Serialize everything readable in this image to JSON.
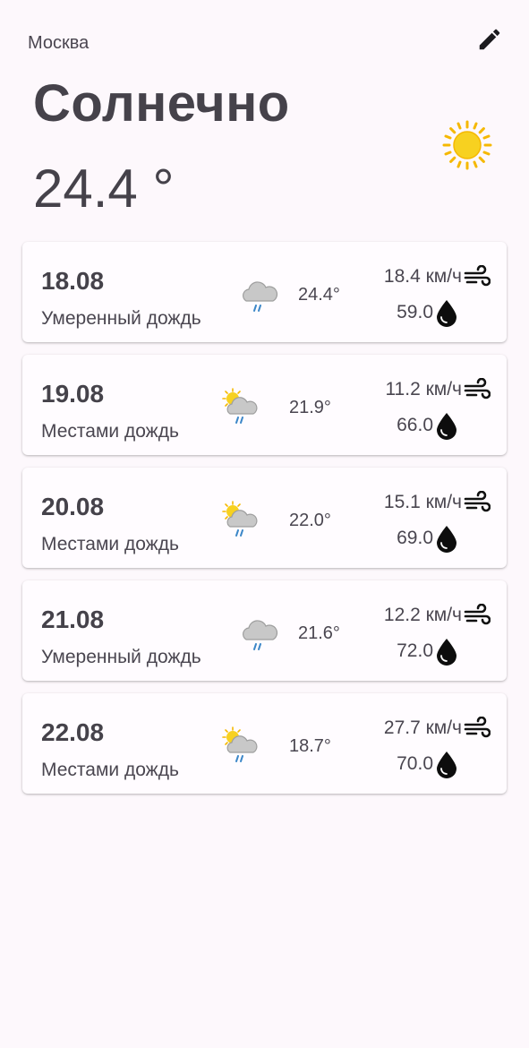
{
  "header": {
    "city": "Москва",
    "edit_icon": "pencil-icon",
    "condition": "Солнечно",
    "temperature": "24.4 °",
    "condition_icon": "sun-icon"
  },
  "colors": {
    "background": "#fdf8fc",
    "text": "#45424a",
    "sun": "#f7d120",
    "cloud": "#b5b5b5",
    "rain": "#3c87c8"
  },
  "forecast": [
    {
      "date": "18.08",
      "description": "Умеренный дождь",
      "icon": "rain-cloud-icon",
      "temp": "24.4°",
      "wind": "18.4 км/ч",
      "humidity": "59.0"
    },
    {
      "date": "19.08",
      "description": "Местами дождь",
      "icon": "sun-cloud-rain-icon",
      "temp": "21.9°",
      "wind": "11.2 км/ч",
      "humidity": "66.0"
    },
    {
      "date": "20.08",
      "description": "Местами дождь",
      "icon": "sun-cloud-rain-icon",
      "temp": "22.0°",
      "wind": "15.1 км/ч",
      "humidity": "69.0"
    },
    {
      "date": "21.08",
      "description": "Умеренный дождь",
      "icon": "rain-cloud-icon",
      "temp": "21.6°",
      "wind": "12.2 км/ч",
      "humidity": "72.0"
    },
    {
      "date": "22.08",
      "description": "Местами дождь",
      "icon": "sun-cloud-rain-icon",
      "temp": "18.7°",
      "wind": "27.7 км/ч",
      "humidity": "70.0"
    }
  ]
}
